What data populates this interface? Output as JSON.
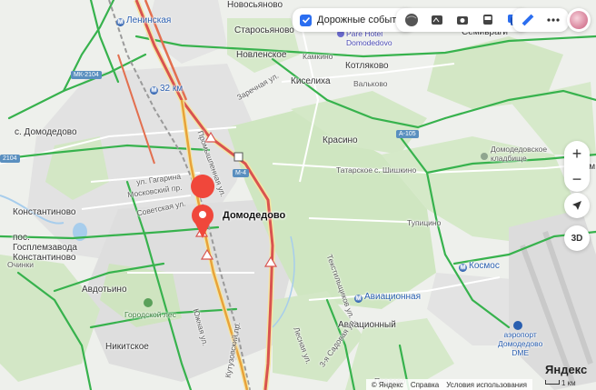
{
  "top_controls": {
    "traffic_label": "Дорожные события",
    "traffic_checked": true,
    "layer_icons": [
      "globe-icon",
      "panorama-icon",
      "camera-icon",
      "bus-icon",
      "layers-icon"
    ],
    "tool_icons": [
      "ruler-icon",
      "more-icon"
    ]
  },
  "map": {
    "selected_place": "Домодедово",
    "places": [
      {
        "id": "leninskaya",
        "text": "Ленинская",
        "kind": "station"
      },
      {
        "id": "novosyanovo",
        "text": "Новосьяново"
      },
      {
        "id": "staroryanovo",
        "text": "Старосьяново"
      },
      {
        "id": "novlenskoe",
        "text": "Новленское"
      },
      {
        "id": "kamkino",
        "text": "Камкино"
      },
      {
        "id": "kiselikha",
        "text": "Киселиха"
      },
      {
        "id": "kotlyakovo",
        "text": "Котляково"
      },
      {
        "id": "valkovo",
        "text": "Вальково"
      },
      {
        "id": "semivragi",
        "text": "Семивраги"
      },
      {
        "id": "s_domodedovo",
        "text": "с. Домодедово"
      },
      {
        "id": "krasino",
        "text": "Красино"
      },
      {
        "id": "tatarskoe",
        "text": "Татарское"
      },
      {
        "id": "shishkino",
        "text": "с. Шишкино"
      },
      {
        "id": "istom",
        "text": "Истом"
      },
      {
        "id": "konstantinovo",
        "text": "Константиново"
      },
      {
        "id": "gosplemzavod",
        "text": "пос.\nГосплемзавода\nКонстантиново"
      },
      {
        "id": "ochinki",
        "text": "Очинки"
      },
      {
        "id": "avdotino",
        "text": "Авдотьино"
      },
      {
        "id": "tupitsino",
        "text": "Тупицино"
      },
      {
        "id": "kosmos",
        "text": "Космос",
        "kind": "station"
      },
      {
        "id": "aviatsionnaya",
        "text": "Авиационная",
        "kind": "station"
      },
      {
        "id": "aviatsionny",
        "text": "Авиационный"
      },
      {
        "id": "nikitskoe",
        "text": "Никитское"
      },
      {
        "id": "povodovo",
        "text": "Повдово"
      },
      {
        "id": "gorodskoy_les",
        "text": "Городской лес"
      },
      {
        "id": "cemetery",
        "text": "Домодедовское\nкладбище"
      },
      {
        "id": "pare_hotel",
        "text": "Pare Hotel\nDomodedovo"
      },
      {
        "id": "airport",
        "text": "аэропорт\nДомодедово\nDME"
      },
      {
        "id": "km32",
        "text": "32 км",
        "kind": "station"
      }
    ],
    "streets": [
      {
        "id": "gagarina",
        "text": "ул. Гагарина"
      },
      {
        "id": "moskovsky",
        "text": "Московский пр."
      },
      {
        "id": "sovetskaya",
        "text": "Советская ул."
      },
      {
        "id": "kutuzovsky",
        "text": "Кутузовский пр."
      },
      {
        "id": "tekstilshchikov",
        "text": "Текстильщиков ул."
      },
      {
        "id": "promyshlennaya",
        "text": "Промышленная ул."
      },
      {
        "id": "zarechnaya",
        "text": "Заречная ул."
      },
      {
        "id": "lesnaya",
        "text": "Лесная ул."
      },
      {
        "id": "yuzhnaya",
        "text": "Южная ул."
      },
      {
        "id": "sadovaya",
        "text": "3-я Садовая ул."
      }
    ],
    "road_shields": [
      "М-4",
      "МК-2104",
      "А-105",
      "2104"
    ]
  },
  "right_controls": {
    "zoom_in": "+",
    "zoom_out": "−",
    "three_d": "3D"
  },
  "footer": {
    "copyright": "© Яндекс",
    "help": "Справка",
    "terms": "Условия использования",
    "scale": "1 км",
    "brand": "Яндекс"
  },
  "colors": {
    "forest": "#cfe6c1",
    "urban": "#e2e2e2",
    "road_traffic_heavy": "#d9534f",
    "road_traffic_ok": "#37b24d",
    "accent": "#2b6ef0",
    "pin": "#f0473b"
  }
}
